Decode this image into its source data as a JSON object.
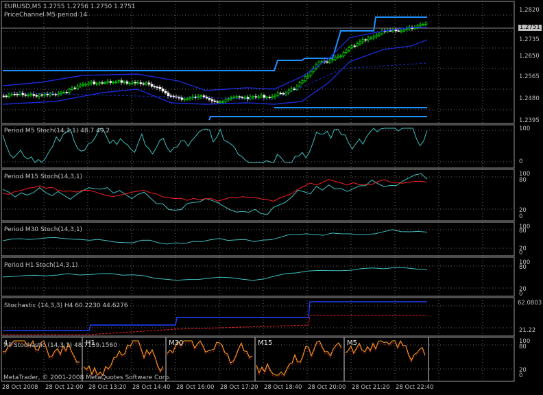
{
  "main": {
    "header": "EURUSD,M5  1.2755 1.2756 1.2750 1.2751",
    "indicator": "PriceChannel  M5  period 14",
    "price_ticks": [
      "1.2820",
      "1.2735",
      "1.2650",
      "1.2565",
      "1.2480",
      "1.2395"
    ],
    "current_price": "1.2751"
  },
  "panes": [
    {
      "label": "Period M5 Stoch(14,3,1) 48.7 49.2",
      "ticks": [
        "100",
        "0"
      ]
    },
    {
      "label": "Period M15 Stoch(14,3,1)",
      "ticks": [
        "100",
        "80",
        "20",
        "0"
      ]
    },
    {
      "label": "Period M30 Stoch(14,3,1)",
      "ticks": [
        "100",
        "80",
        "20",
        "0"
      ]
    },
    {
      "label": "Period H1 Stoch(14,3,1)",
      "ticks": [
        "100",
        "80",
        "20",
        "0"
      ]
    },
    {
      "label": "Stochastic (14,3,3) H4 60.2230 44.6276",
      "ticks": [
        "62.0803",
        "21.22"
      ]
    },
    {
      "label": "All Stochastic (14,3,1) 48.7159.1560",
      "ticks": [
        "100",
        "80",
        "20",
        "0"
      ]
    }
  ],
  "timeframes": [
    "4",
    "H1",
    "M30",
    "M15",
    "M5"
  ],
  "copyright": "MetaTrader, © 2001-2008 MetaQuotes Software Corp.",
  "time_axis": [
    "28 Oct 2008",
    "28 Oct 12:00",
    "28 Oct 13:20",
    "28 Oct 14:40",
    "28 Oct 16:00",
    "28 Oct 17:20",
    "28 Oct 18:40",
    "28 Oct 20:00",
    "28 Oct 21:20",
    "28 Oct 22:40"
  ],
  "colors": {
    "background": "#000000",
    "grid": "#6e6e6e",
    "frame": "#9a9a9a",
    "bull_candle": "#00ff00",
    "channel_outer": "#1e90ff",
    "channel_inner": "#1a2ad6",
    "stoch_main": "#40c0c0",
    "stoch_signal": "#ff2020",
    "all_stoch": "#ffa020"
  }
}
